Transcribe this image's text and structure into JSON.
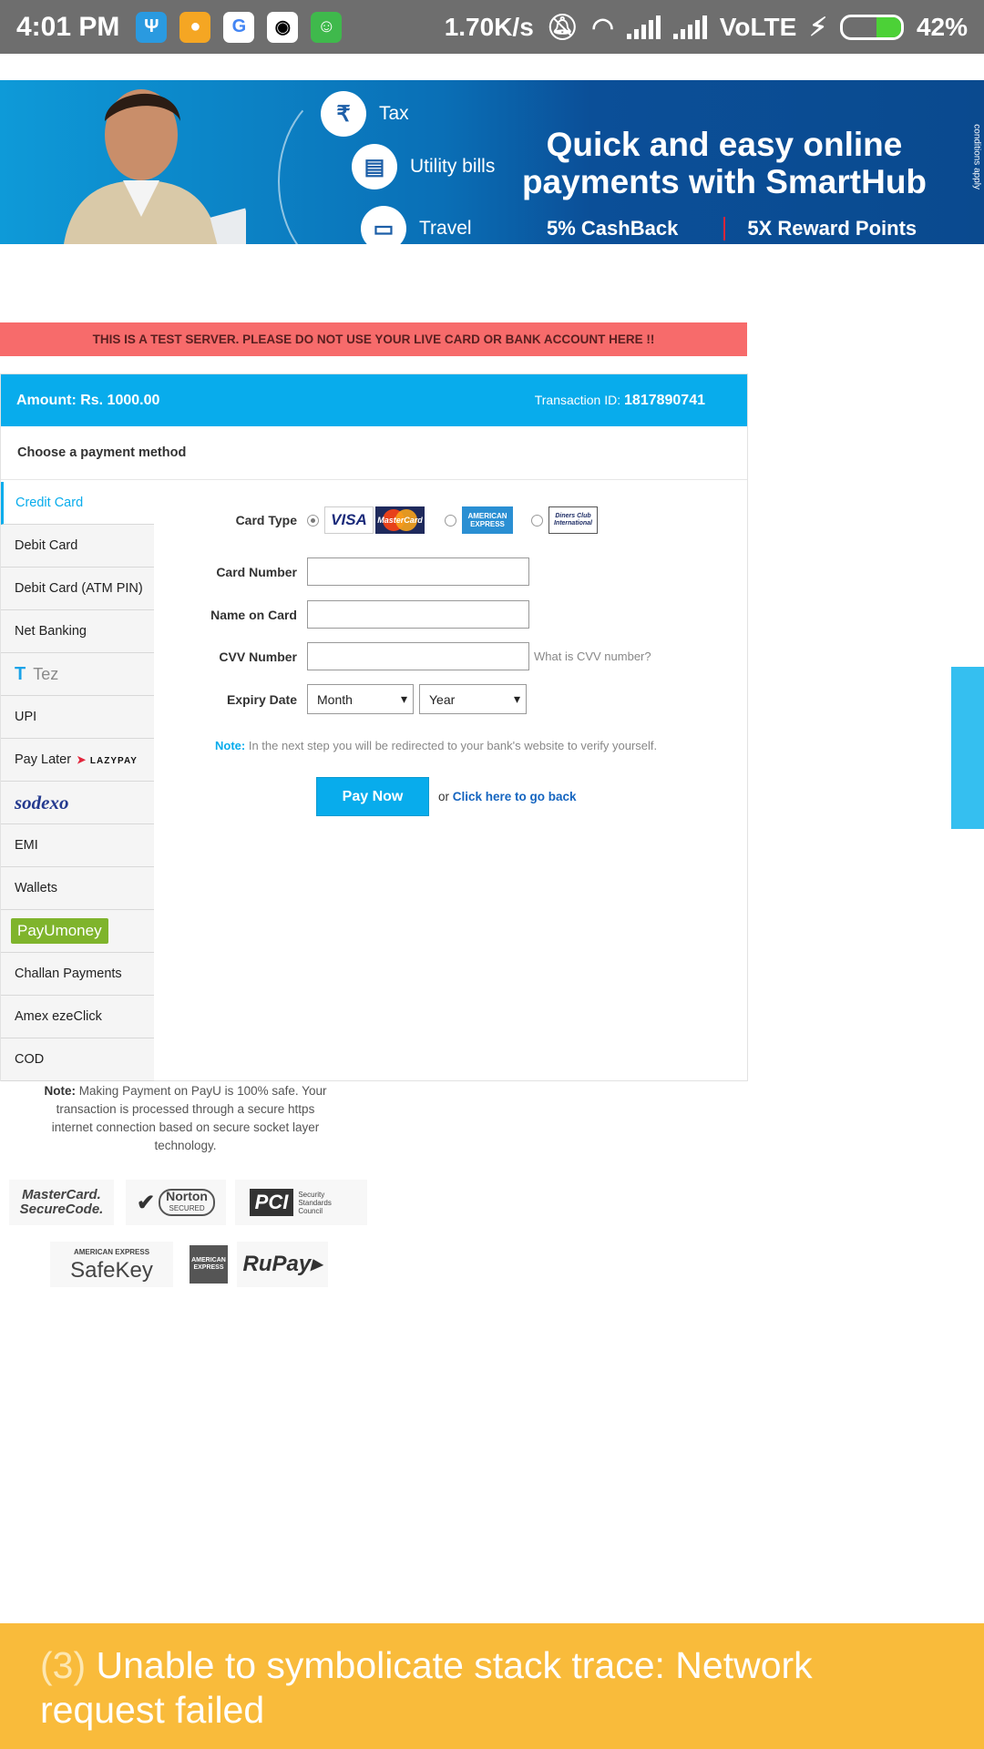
{
  "status_bar": {
    "time": "4:01 PM",
    "network_speed": "1.70K/s",
    "network_type": "VoLTE",
    "battery_percent": "42%",
    "battery_level": 0.42,
    "app_icons": [
      "usb-icon",
      "chat-app-icon",
      "google-icon",
      "camera-app-icon",
      "android-app-icon"
    ]
  },
  "banner": {
    "items": [
      "Tax",
      "Utility bills",
      "Travel"
    ],
    "headline_line1": "Quick and easy online",
    "headline_line2": "payments with SmartHub",
    "offer1": "5% CashBack",
    "offer2": "5X Reward Points",
    "tc": "conditions apply"
  },
  "test_notice": "THIS IS A TEST SERVER. PLEASE DO NOT USE YOUR LIVE CARD OR BANK ACCOUNT HERE !!",
  "header": {
    "amount_label": "Amount",
    "amount_value": ": Rs. 1000.00",
    "txn_label": "Transaction ID: ",
    "txn_value": "1817890741"
  },
  "choose_label": "Choose a payment method",
  "methods": [
    {
      "label": "Credit Card",
      "active": true
    },
    {
      "label": "Debit Card"
    },
    {
      "label": "Debit Card (ATM PIN)"
    },
    {
      "label": "Net Banking"
    },
    {
      "label": "Tez"
    },
    {
      "label": "UPI"
    },
    {
      "label": "Pay Later",
      "logo": "LAZYPAY"
    },
    {
      "label": "sodexo"
    },
    {
      "label": "EMI"
    },
    {
      "label": "Wallets"
    },
    {
      "label": "PayUmoney"
    },
    {
      "label": "Challan Payments"
    },
    {
      "label": "Amex ezeClick"
    },
    {
      "label": "COD"
    }
  ],
  "form": {
    "card_type_label": "Card Type",
    "card_logos": {
      "visa": "VISA",
      "mastercard": "MasterCard",
      "amex": "AMERICAN EXPRESS",
      "diners": "Diners Club International"
    },
    "card_number_label": "Card Number",
    "card_number_value": "",
    "name_label": "Name on Card",
    "name_value": "",
    "cvv_label": "CVV Number",
    "cvv_value": "",
    "cvv_help": "What is CVV number?",
    "expiry_label": "Expiry Date",
    "month_selected": "Month",
    "year_selected": "Year",
    "note_label": "Note:",
    "note_text": " In the next step you will be redirected to your bank's website to verify yourself.",
    "pay_button": "Pay Now",
    "go_back_prefix": "or ",
    "go_back_link": "Click here to go back"
  },
  "secure_note": {
    "label": "Note:",
    "text": " Making Payment on PayU is 100% safe. Your transaction is processed through a secure https internet connection based on secure socket layer technology."
  },
  "badges": {
    "mastercard_securecode": "MasterCard. SecureCode.",
    "norton": "Norton",
    "norton_sub": "SECURED",
    "pci": "PCI",
    "pci_sub": "Security Standards Council",
    "safekey_top": "AMERICAN EXPRESS",
    "safekey": "SafeKey",
    "amex_small": "AMERICAN EXPRESS",
    "rupay": "RuPay"
  },
  "error": {
    "count": "(3)",
    "message": " Unable to symbolicate stack trace: Network request failed"
  },
  "colors": {
    "primary": "#08acec",
    "notice": "#f76b6b",
    "error": "#f9bb3b",
    "status_bar": "#6e6e6e"
  }
}
